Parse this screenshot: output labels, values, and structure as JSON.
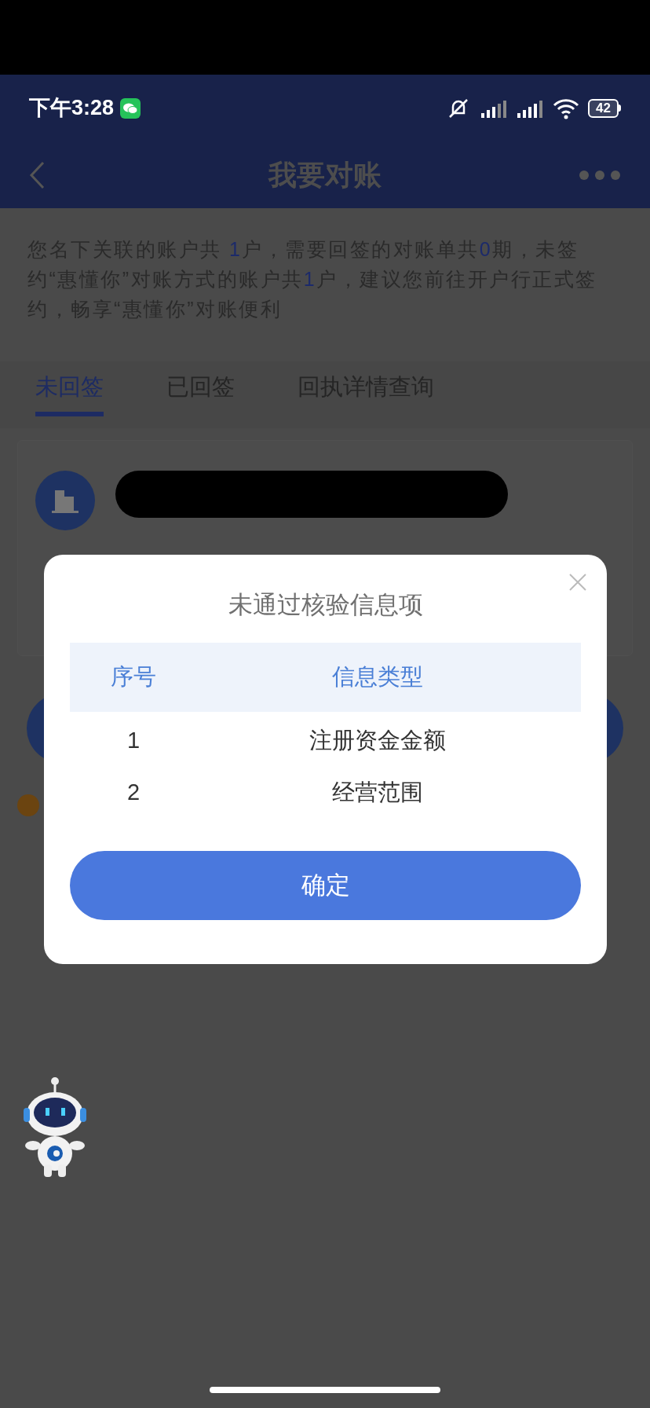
{
  "status_bar": {
    "time": "下午3:28",
    "battery": "42"
  },
  "nav": {
    "title": "我要对账"
  },
  "notice": [
    {
      "text": "您名下关联的账户共 ",
      "highlight": false
    },
    {
      "text": "1",
      "highlight": true
    },
    {
      "text": "户，需要回签的对账单共",
      "highlight": false
    },
    {
      "text": "0",
      "highlight": true
    },
    {
      "text": "期，未签约“惠懂你”对账方式的账户共",
      "highlight": false
    },
    {
      "text": "1",
      "highlight": true
    },
    {
      "text": "户，建议您前往开户行正式签约，畅享“惠懂你”对账便利",
      "highlight": false
    }
  ],
  "tabs": [
    {
      "label": "未回签",
      "selected": true
    },
    {
      "label": "已回签",
      "selected": false
    },
    {
      "label": "回执详情查询",
      "selected": false
    }
  ],
  "dialog": {
    "title": "未通过核验信息项",
    "columns": [
      "序号",
      "信息类型"
    ],
    "rows": [
      [
        "1",
        "注册资金金额"
      ],
      [
        "2",
        "经营范围"
      ]
    ],
    "confirm": "确定"
  }
}
